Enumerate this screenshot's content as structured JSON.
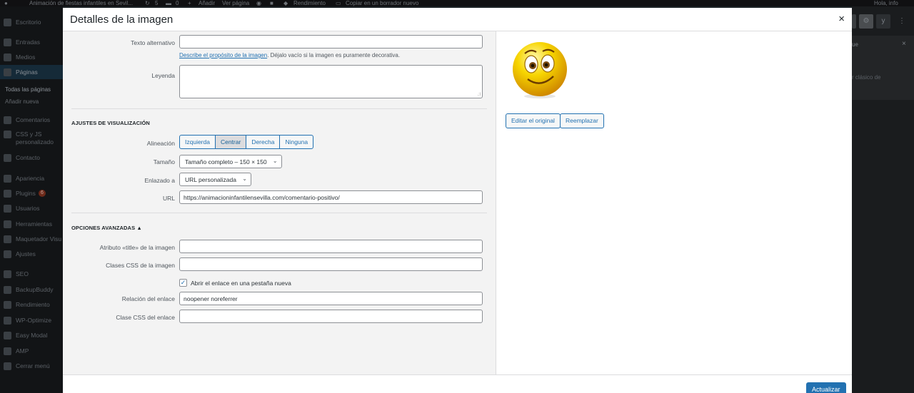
{
  "adminbar": {
    "site": "Animación de fiestas infantiles en Sevil...",
    "updates": "5",
    "comments": "0",
    "new": "Añadir",
    "view": "Ver página",
    "performance": "Rendimiento",
    "copy": "Copiar en un borrador nuevo",
    "greeting": "Hola, info"
  },
  "sidebar": {
    "items": [
      {
        "label": "Escritorio"
      },
      {
        "label": "Entradas"
      },
      {
        "label": "Medios"
      },
      {
        "label": "Páginas"
      },
      {
        "label": "Comentarios"
      },
      {
        "label": "CSS y JS"
      },
      {
        "label": "Contacto"
      },
      {
        "label": "Apariencia"
      },
      {
        "label": "Plugins"
      },
      {
        "label": "Usuarios"
      },
      {
        "label": "Herramientas"
      },
      {
        "label": "Maquetador Visu"
      },
      {
        "label": "Ajustes"
      },
      {
        "label": "SEO"
      },
      {
        "label": "BackupBuddy"
      },
      {
        "label": "Rendimiento"
      },
      {
        "label": "WP-Optimize"
      },
      {
        "label": "Easy Modal"
      },
      {
        "label": "AMP"
      },
      {
        "label": "Cerrar menú"
      }
    ],
    "css_js_line2": "personalizado",
    "plugins_badge": "6",
    "sub_all_pages": "Todas las páginas",
    "sub_add_new": "Añadir nueva"
  },
  "editor_right": {
    "tab": "ue",
    "close": "×",
    "text": "r clásico de",
    "yoast": "y",
    "more": "⋮"
  },
  "modal": {
    "title": "Detalles de la imagen",
    "close": "×",
    "alt_label": "Texto alternativo",
    "alt_value": "",
    "alt_help_link": "Describe el propósito de la imagen",
    "alt_help_text": ". Déjalo vacío si la imagen es puramente decorativa.",
    "caption_label": "Leyenda",
    "caption_value": "",
    "display_title": "AJUSTES DE VISUALIZACIÓN",
    "align_label": "Alineación",
    "align_options": [
      "Izquierda",
      "Centrar",
      "Derecha",
      "Ninguna"
    ],
    "align_selected": "Centrar",
    "size_label": "Tamaño",
    "size_value": "Tamaño completo – 150 × 150",
    "link_label": "Enlazado a",
    "link_value": "URL personalizada",
    "url_label": "URL",
    "url_value": "https://animacioninfantilensevilla.com/comentario-positivo/",
    "advanced_title": "OPCIONES AVANZADAS",
    "advanced_arrow": "▲",
    "title_attr_label": "Atributo «title» de la imagen",
    "title_attr_value": "",
    "css_label": "Clases CSS de la imagen",
    "css_value": "",
    "newtab_label": "Abrir el enlace en una pestaña nueva",
    "newtab_checked": true,
    "rel_label": "Relación del enlace",
    "rel_value": "noopener noreferrer",
    "link_css_label": "Clase CSS del enlace",
    "link_css_value": "",
    "edit_original": "Editar el original",
    "replace": "Reemplazar",
    "update": "Actualizar"
  },
  "colors": {
    "accent": "#2271b1",
    "modal_bg": "#ffffff",
    "settings_bg": "#f3f3f3",
    "admin_dark": "#1d2327"
  },
  "icons": {
    "check": "✓",
    "chevron": "⌄"
  }
}
